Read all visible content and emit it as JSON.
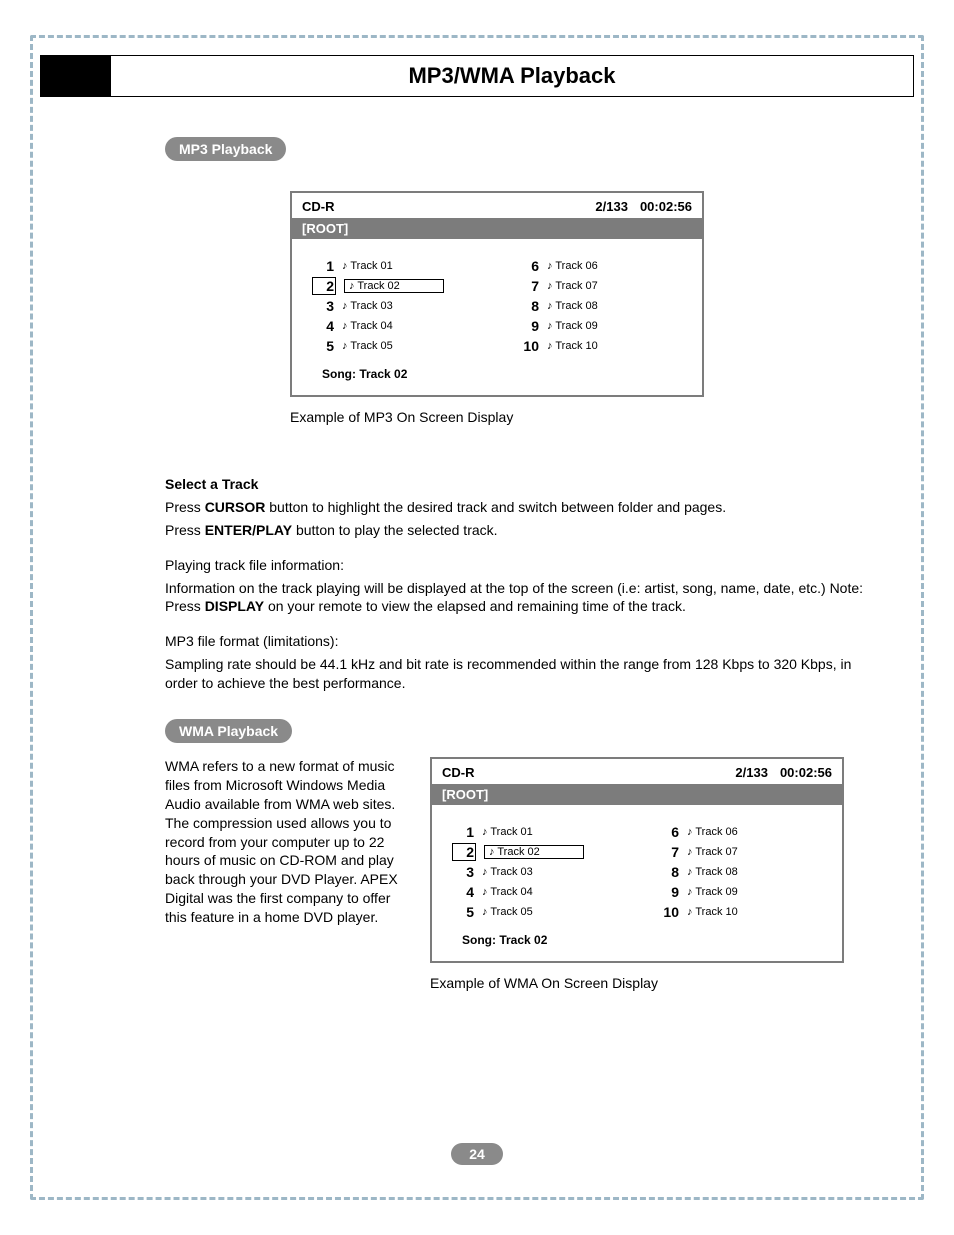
{
  "title": "MP3/WMA Playback",
  "section1": {
    "heading": "MP3 Playback"
  },
  "section2": {
    "heading": "WMA Playback"
  },
  "osd": {
    "disc": "CD-R",
    "counter": "2/133",
    "time": "00:02:56",
    "root": "[ROOT]",
    "left": [
      {
        "num": "1",
        "label": "Track 01"
      },
      {
        "num": "2",
        "label": "Track 02",
        "selected": true
      },
      {
        "num": "3",
        "label": "Track 03"
      },
      {
        "num": "4",
        "label": "Track 04"
      },
      {
        "num": "5",
        "label": "Track 05"
      }
    ],
    "right": [
      {
        "num": "6",
        "label": "Track 06"
      },
      {
        "num": "7",
        "label": "Track 07"
      },
      {
        "num": "8",
        "label": "Track 08"
      },
      {
        "num": "9",
        "label": "Track 09"
      },
      {
        "num": "10",
        "label": "Track 10"
      }
    ],
    "note_glyph": "♪",
    "song_label": "Song: Track 02"
  },
  "captions": {
    "mp3": "Example of MP3 On Screen Display",
    "wma": "Example of WMA On Screen Display"
  },
  "body": {
    "select_heading": "Select a Track",
    "p1a": "Press ",
    "p1b": "CURSOR",
    "p1c": " button to highlight the desired track and switch between folder and pages.",
    "p2a": "Press ",
    "p2b": "ENTER/PLAY",
    "p2c": " button to play the selected track.",
    "p3": "Playing track file information:",
    "p4a": "Information on the track playing will be displayed at the top of the screen (i.e: artist, song, name, date, etc.) Note: Press ",
    "p4b": "DISPLAY",
    "p4c": " on your remote to view the elapsed and remaining time of the track.",
    "p5": "MP3 file format (limitations):",
    "p6": "Sampling rate should be 44.1 kHz and bit rate is recommended within the range from 128 Kbps to 320 Kbps, in order to achieve the best performance.",
    "wma_para": "WMA refers to a new format of music files from Microsoft Windows Media Audio available from WMA web sites. The compression used allows you to record from your computer up to 22 hours of music on CD-ROM and play back through your DVD Player. APEX Digital was the first company to offer this feature in a home DVD player."
  },
  "page_number": "24"
}
